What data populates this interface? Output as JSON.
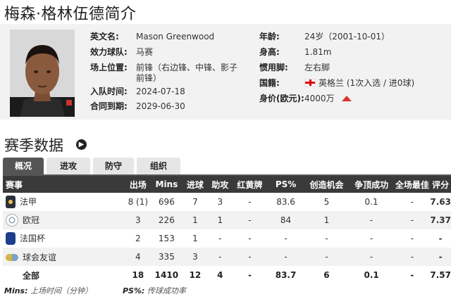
{
  "page_title": "梅森·格林伍德简介",
  "profile": {
    "english_name_label": "英文名:",
    "english_name": "Mason Greenwood",
    "club_label": "效力球队:",
    "club": "马赛",
    "position_label": "场上位置:",
    "position_line1": "前锋（右边锋、中锋、影子",
    "position_line2": "前锋）",
    "joined_label": "入队时间:",
    "joined": "2024-07-18",
    "contract_label": "合同到期:",
    "contract": "2029-06-30",
    "age_label": "年龄:",
    "age": "24岁（2001-10-01）",
    "height_label": "身高:",
    "height": "1.81m",
    "foot_label": "惯用脚:",
    "foot": "左右脚",
    "nationality_label": "国籍:",
    "nationality": "英格兰 (1次入选 / 进0球)",
    "value_label": "身价(欧元):",
    "value": "4000万",
    "value_trend": "up"
  },
  "season": {
    "title": "赛季数据",
    "tabs": [
      "概况",
      "进攻",
      "防守",
      "组织"
    ],
    "active_tab": "概况",
    "headers": [
      "赛事",
      "出场",
      "Mins",
      "进球",
      "助攻",
      "红黄牌",
      "PS%",
      "创造机会",
      "争顶成功",
      "全场最佳",
      "评分"
    ],
    "rows": [
      {
        "icon": "ligue1-icon",
        "comp": "法甲",
        "apps": "8 (1)",
        "mins": "696",
        "goals": "7",
        "assists": "3",
        "cards": "-",
        "ps": "83.6",
        "chances": "5",
        "aerials": "0.1",
        "motm": "-",
        "rating": "7.63"
      },
      {
        "icon": "champions-league-icon",
        "comp": "欧冠",
        "apps": "3",
        "mins": "226",
        "goals": "1",
        "assists": "1",
        "cards": "-",
        "ps": "84",
        "chances": "1",
        "aerials": "-",
        "motm": "-",
        "rating": "7.37"
      },
      {
        "icon": "coupe-de-france-icon",
        "comp": "法国杯",
        "apps": "2",
        "mins": "153",
        "goals": "1",
        "assists": "-",
        "cards": "-",
        "ps": "-",
        "chances": "-",
        "aerials": "-",
        "motm": "-",
        "rating": "-"
      },
      {
        "icon": "club-friendly-icon",
        "comp": "球会友谊",
        "apps": "4",
        "mins": "335",
        "goals": "3",
        "assists": "-",
        "cards": "-",
        "ps": "-",
        "chances": "-",
        "aerials": "-",
        "motm": "-",
        "rating": "-"
      }
    ],
    "total": {
      "comp": "全部",
      "apps": "18",
      "mins": "1410",
      "goals": "12",
      "assists": "4",
      "cards": "-",
      "ps": "83.7",
      "chances": "6",
      "aerials": "0.1",
      "motm": "-",
      "rating": "7.57"
    }
  },
  "footnote": {
    "mins_key": "Mins:",
    "mins_desc": " 上场时间（分钟）",
    "ps_key": "PS%:",
    "ps_desc": " 传球成功率"
  },
  "colors": {
    "header_bg": "#3a3a3a",
    "rating": "#e0701c",
    "trend_up": "#d9342b",
    "profile_bg": "#f2f2f2"
  }
}
